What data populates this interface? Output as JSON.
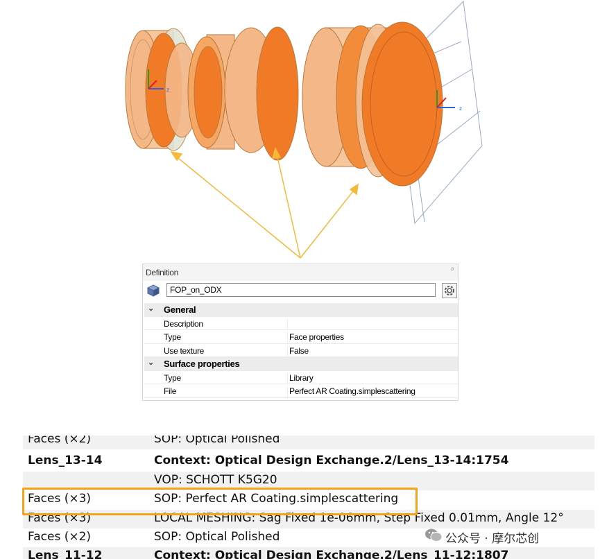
{
  "viewport": {
    "axis_labels": {
      "left_z": "z",
      "right_z": "z"
    },
    "colors": {
      "lens_light": "#f4b888",
      "lens_dark": "#f07a26",
      "lens_edge": "#b06a2a",
      "grey_lens": "#c8d2c8",
      "arrow": "#f4b93a",
      "plane": "#9aa8c8"
    }
  },
  "definition": {
    "title": "Definition",
    "pin": "ᵖ",
    "name_value": "FOP_on_ODX",
    "groups": [
      {
        "label": "General",
        "rows": [
          {
            "name": "Description",
            "value": ""
          },
          {
            "name": "Type",
            "value": "Face properties"
          },
          {
            "name": "Use texture",
            "value": "False"
          }
        ]
      },
      {
        "label": "Surface properties",
        "rows": [
          {
            "name": "Type",
            "value": "Library"
          },
          {
            "name": "File",
            "value": "Perfect AR Coating.simplescattering"
          }
        ]
      }
    ]
  },
  "lens_table": {
    "rows": [
      {
        "c1": "Faces (×2)",
        "c2": "SOP: Optical Polished",
        "bold": false
      },
      {
        "c1": "Lens_13-14",
        "c2": "Context: Optical Design Exchange.2/Lens_13-14:1754",
        "bold": true
      },
      {
        "c1": "",
        "c2": "VOP: SCHOTT K5G20",
        "bold": false
      },
      {
        "c1": "Faces (×3)",
        "c2": "SOP: Perfect AR Coating.simplescattering",
        "bold": false
      },
      {
        "c1": "Faces (×3)",
        "c2": "LOCAL MESHING: Sag Fixed 1e-06mm, Step Fixed 0.01mm, Angle 12°",
        "bold": false
      },
      {
        "c1": "Faces (×2)",
        "c2": "SOP: Optical Polished",
        "bold": false
      },
      {
        "c1": "Lens_11-12",
        "c2": "Context: Optical Design Exchange.2/Lens_11-12:1807",
        "bold": true
      }
    ]
  },
  "watermark": {
    "text": "公众号 · 摩尔芯创"
  }
}
